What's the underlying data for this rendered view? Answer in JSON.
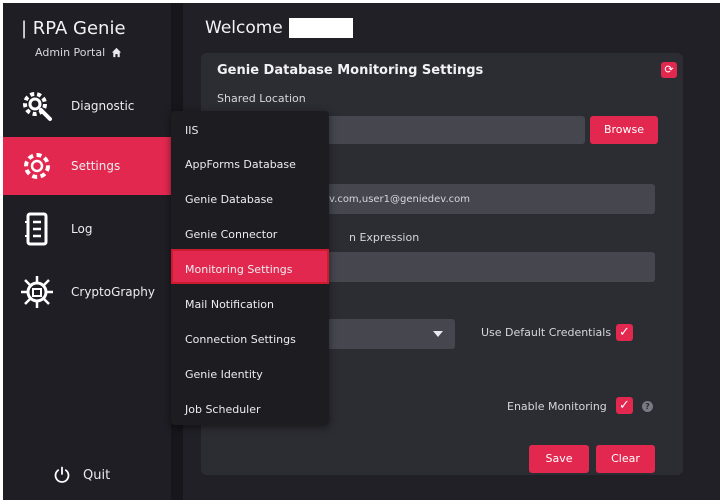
{
  "brand": {
    "title": "| RPA Genie",
    "subtitle": "Admin Portal"
  },
  "sidebar": {
    "items": [
      {
        "label": "Diagnostic",
        "icon": "diagnostic-gear-icon"
      },
      {
        "label": "Settings",
        "icon": "settings-gear-icon",
        "active": true
      },
      {
        "label": "Log",
        "icon": "log-document-icon"
      },
      {
        "label": "CryptoGraphy",
        "icon": "virus-chip-icon"
      }
    ],
    "quit": "Quit"
  },
  "header": {
    "welcome": "Welcome"
  },
  "panel": {
    "title": "Genie Database Monitoring Settings",
    "shared_location_label": "Shared Location",
    "browse": "Browse",
    "emails_value": "v.com,user1@geniedev.com",
    "expression_label": "n Expression",
    "use_default_credentials": "Use Default Credentials",
    "enable_monitoring": "Enable Monitoring",
    "save": "Save",
    "clear": "Clear"
  },
  "submenu": {
    "items": [
      "IIS",
      "AppForms Database",
      "Genie Database",
      "Genie Connector",
      "Monitoring Settings",
      "Mail Notification",
      "Connection Settings",
      "Genie Identity",
      "Job Scheduler"
    ],
    "highlighted": "Monitoring Settings"
  },
  "colors": {
    "accent": "#e3284f",
    "sidebar": "#1e1e24",
    "panel": "#2c2c33"
  }
}
